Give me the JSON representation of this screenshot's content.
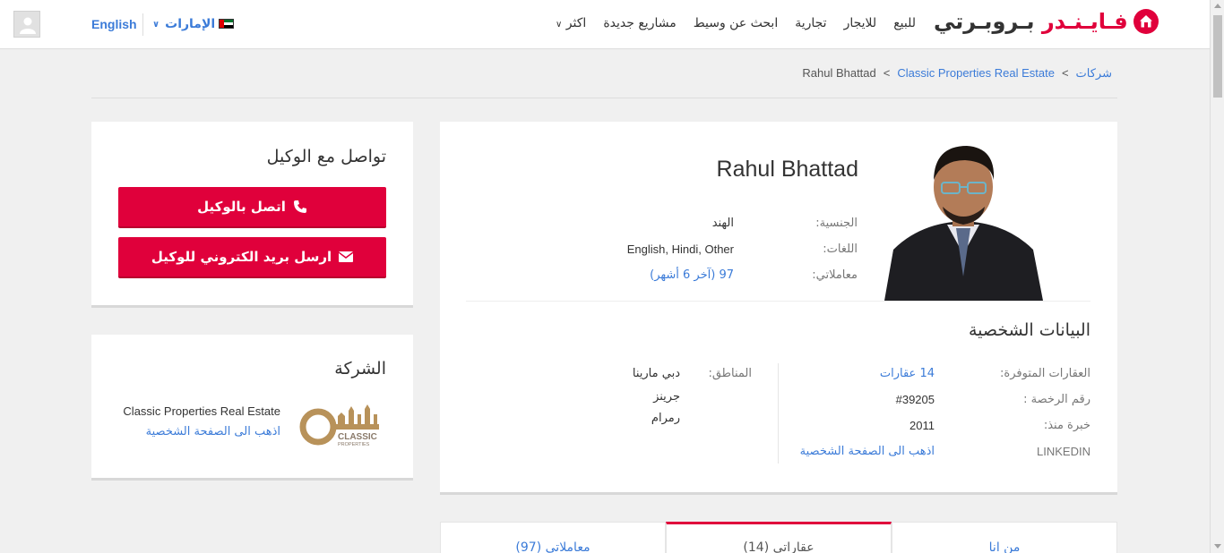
{
  "header": {
    "logo_text_part1": "بـروبـرتي",
    "logo_text_part2": "فـايـنـدر",
    "nav": [
      "للبيع",
      "للايجار",
      "تجارية",
      "ابحث عن وسيط",
      "مشاريع جديدة",
      "اكثر"
    ],
    "country": "الإمارات",
    "language": "English"
  },
  "breadcrumb": {
    "items": [
      "شركات",
      "Classic Properties Real Estate",
      "Rahul Bhattad"
    ],
    "separator": ">"
  },
  "agent": {
    "name": "Rahul Bhattad",
    "nationality_label": "الجنسية:",
    "nationality": "الهند",
    "languages_label": "اللغات:",
    "languages": "English, Hindi, Other",
    "transactions_label": "معاملاتي:",
    "transactions": "97 (آخر 6 أشهر)"
  },
  "personal": {
    "title": "البيانات الشخصية",
    "properties_label": "العقارات المتوفرة:",
    "properties": "14 عقارات",
    "license_label": "رقم الرخصة :",
    "license": "#39205",
    "experience_label": "خبرة منذ:",
    "experience": "2011",
    "linkedin_label": "LINKEDIN",
    "linkedin_link": "اذهب الى الصفحة الشخصية",
    "areas_label": "المناطق:",
    "areas": [
      "دبي مارينا",
      "جرينز",
      "رمرام"
    ]
  },
  "contact": {
    "title": "تواصل مع الوكيل",
    "call_label": "اتصل بالوكيل",
    "email_label": "ارسل بريد الكتروني للوكيل"
  },
  "company": {
    "title": "الشركة",
    "name": "Classic Properties Real Estate",
    "link": "اذهب الى الصفحة الشخصية",
    "logo_text": "CLASSIC",
    "logo_subtext": "PROPERTIES"
  },
  "tabs": [
    "معاملاتي (97)",
    "عقاراتي (14)",
    "من انا"
  ],
  "colors": {
    "brand": "#e0003b",
    "link": "#3b7bd8"
  }
}
